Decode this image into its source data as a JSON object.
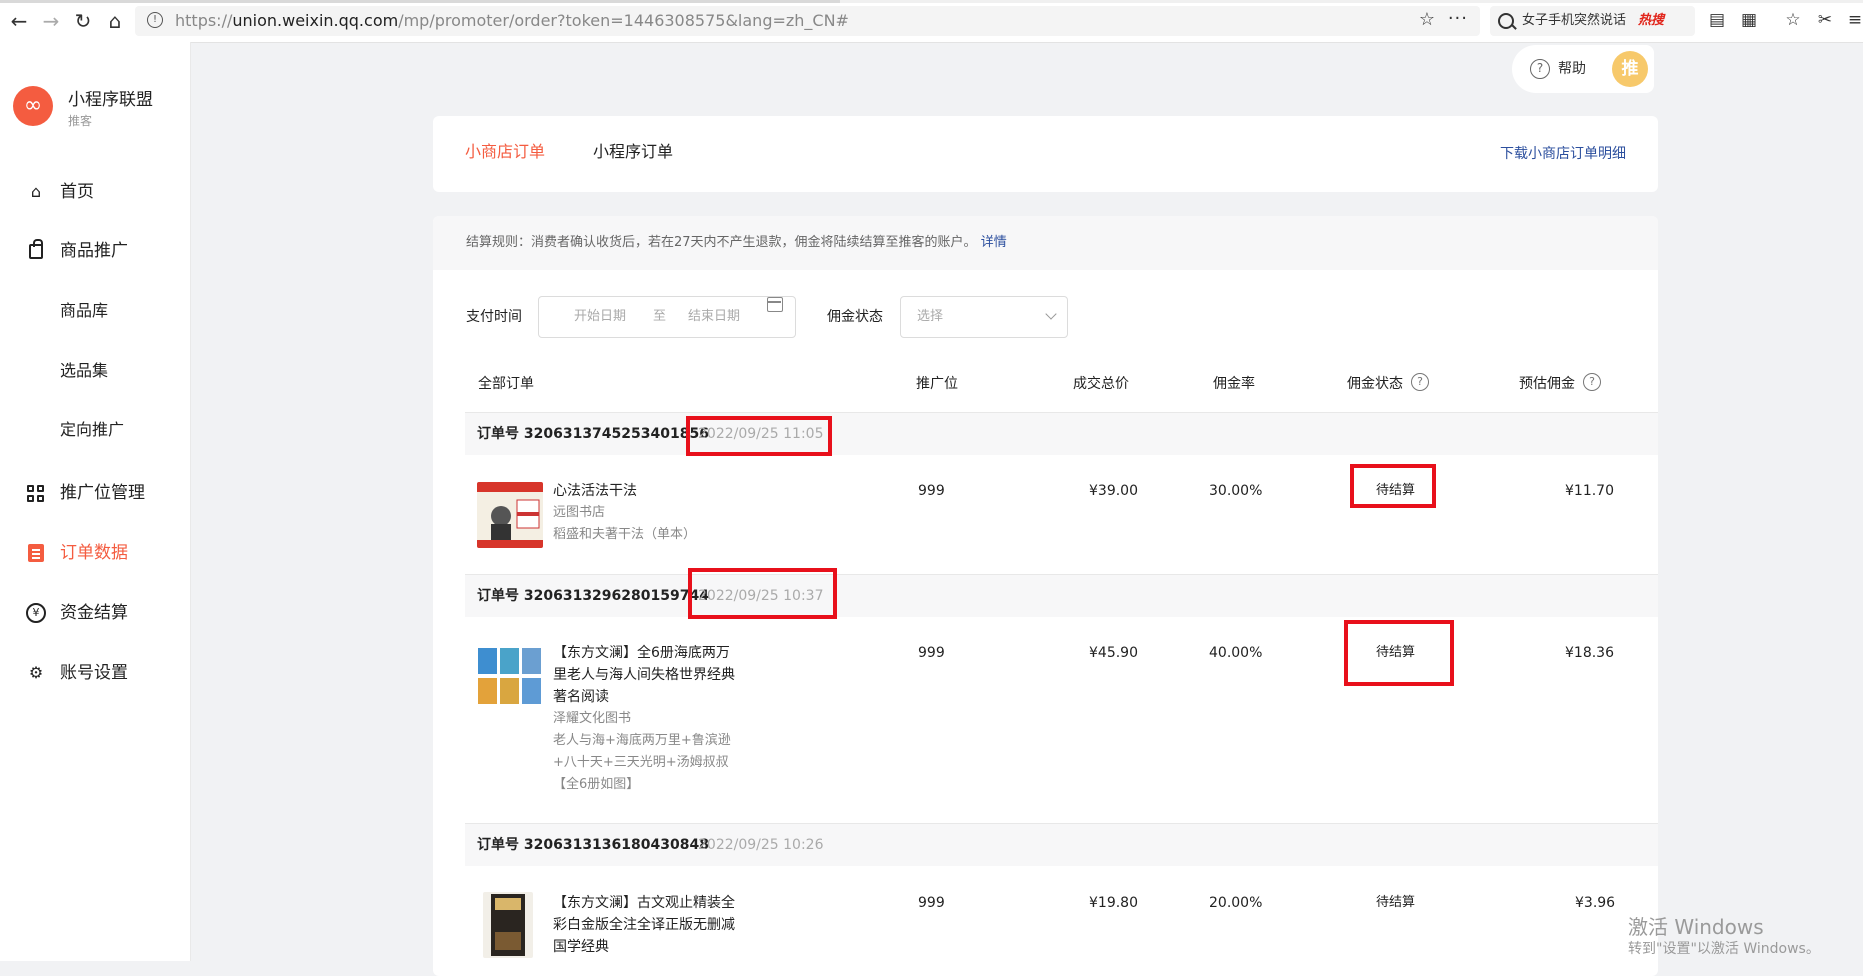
{
  "browser": {
    "url_prefix": "https://",
    "url_domain": "union.weixin.qq.com",
    "url_path": "/mp/promoter/order?token=1446308575&lang=zh_CN#",
    "search_text": "女子手机突然说话",
    "hot_label": "热搜"
  },
  "sidebar": {
    "brand": "小程序联盟",
    "role": "推客",
    "items": [
      {
        "label": "首页",
        "icon": "home-icon"
      },
      {
        "label": "商品推广",
        "icon": "shopping-bag-icon"
      },
      {
        "label": "商品库"
      },
      {
        "label": "选品集"
      },
      {
        "label": "定向推广"
      },
      {
        "label": "推广位管理",
        "icon": "grid-icon"
      },
      {
        "label": "订单数据",
        "icon": "order-icon"
      },
      {
        "label": "资金结算",
        "icon": "yuan-icon"
      },
      {
        "label": "账号设置",
        "icon": "gear-icon"
      }
    ]
  },
  "header": {
    "help": "帮助",
    "avatar": "推"
  },
  "tabs": {
    "shop_orders": "小商店订单",
    "mini_orders": "小程序订单",
    "download": "下载小商店订单明细"
  },
  "rule": {
    "text": "结算规则：消费者确认收货后，若在27天内不产生退款，佣金将陆续结算至推客的账户。",
    "detail": "详情"
  },
  "filters": {
    "pay_time_label": "支付时间",
    "start_placeholder": "开始日期",
    "to": "至",
    "end_placeholder": "结束日期",
    "status_label": "佣金状态",
    "status_placeholder": "选择"
  },
  "columns": {
    "all": "全部订单",
    "slot": "推广位",
    "total": "成交总价",
    "rate": "佣金率",
    "status": "佣金状态",
    "est": "预估佣金"
  },
  "orders": [
    {
      "no": "订单号 3206313745253401856",
      "time": "2022/09/25 11:05",
      "name": "心法活法干法",
      "shop": "远图书店",
      "spec": "稻盛和夫著干法（单本）",
      "slot": "999",
      "total": "¥39.00",
      "rate": "30.00%",
      "status": "待结算",
      "est": "¥11.70"
    },
    {
      "no": "订单号 3206313296280159744",
      "time": "2022/09/25 10:37",
      "name": "【东方文澜】全6册海底两万里老人与海人间失格世界经典著名阅读",
      "shop": "泽耀文化图书",
      "spec": "老人与海+海底两万里+鲁滨逊+八十天+三天光明+汤姆叔叔【全6册如图】",
      "slot": "999",
      "total": "¥45.90",
      "rate": "40.00%",
      "status": "待结算",
      "est": "¥18.36"
    },
    {
      "no": "订单号 3206313136180430848",
      "time": "2022/09/25 10:26",
      "name": "【东方文澜】古文观止精装全彩白金版全注全译正版无删减国学经典",
      "slot": "999",
      "total": "¥19.80",
      "rate": "20.00%",
      "status": "待结算",
      "est": "¥3.96"
    }
  ],
  "watermark": {
    "title": "激活 Windows",
    "sub": "转到\"设置\"以激活 Windows。"
  }
}
